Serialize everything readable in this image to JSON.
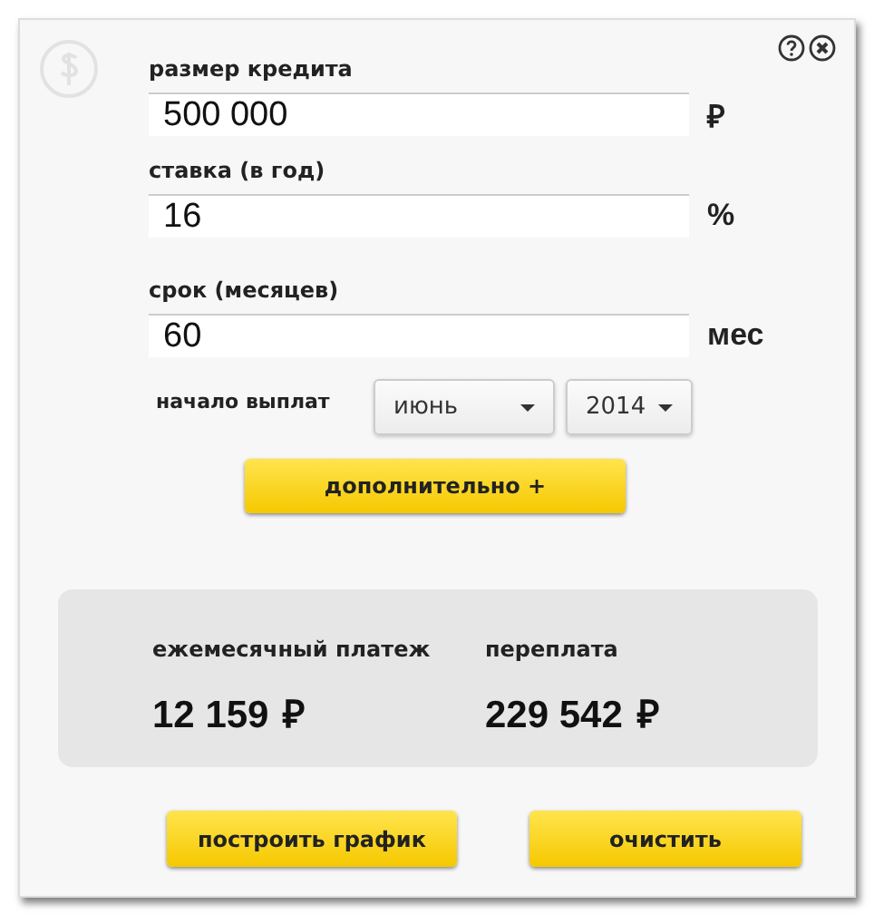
{
  "fields": [
    {
      "label": "размер кредита",
      "value": "500 000",
      "unit": "₽"
    },
    {
      "label": "ставка (в год)",
      "value": "16",
      "unit": "%"
    },
    {
      "label": "срок (месяцев)",
      "value": "60",
      "unit": "мес"
    }
  ],
  "start": {
    "label": "начало выплат",
    "month": "июнь",
    "year": "2014"
  },
  "more_button": "дополнительно +",
  "results": [
    {
      "label": "ежемесячный платеж",
      "value": "12 159",
      "currency": "₽"
    },
    {
      "label": "переплата",
      "value": "229 542",
      "currency": "₽"
    }
  ],
  "buttons": [
    "построить график",
    "очистить"
  ]
}
